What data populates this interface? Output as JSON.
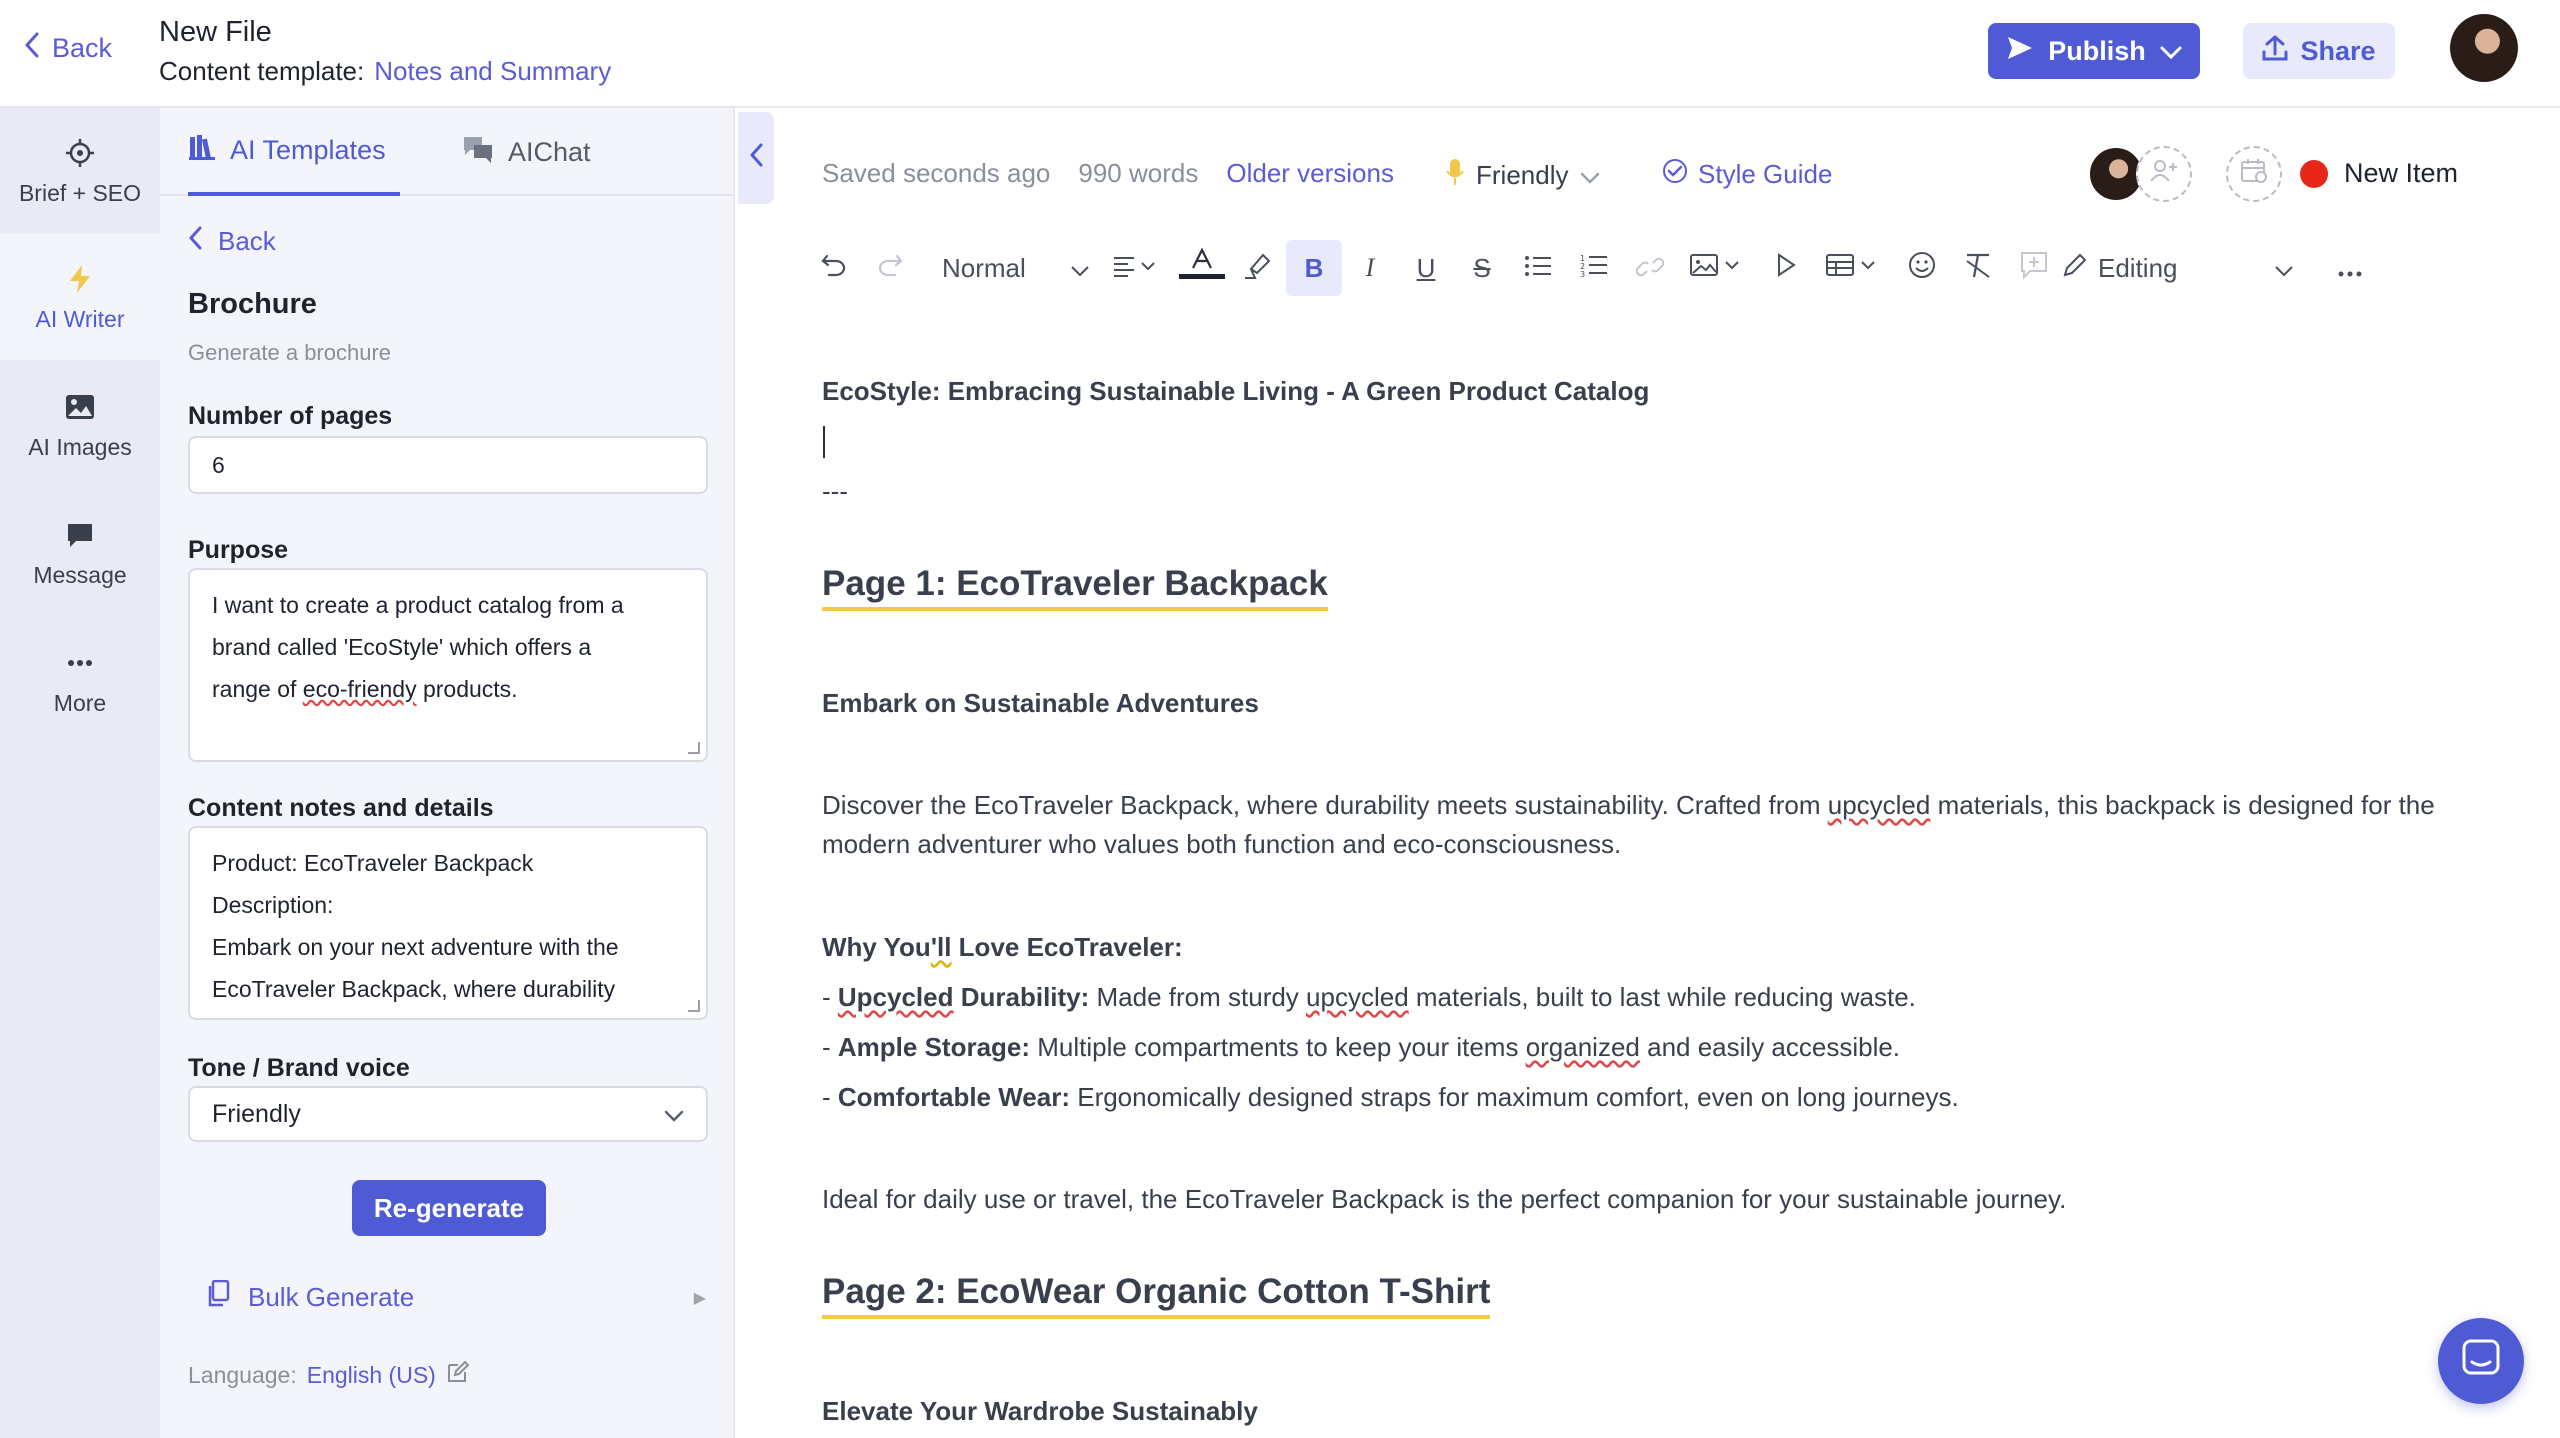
{
  "header": {
    "back_label": "Back",
    "file_title": "New File",
    "template_prefix": "Content template:",
    "template_name": "Notes and Summary",
    "publish_label": "Publish",
    "share_label": "Share"
  },
  "rail": {
    "items": [
      {
        "label": "Brief + SEO",
        "icon": "crosshair-icon"
      },
      {
        "label": "AI Writer",
        "icon": "lightning-icon"
      },
      {
        "label": "AI Images",
        "icon": "image-icon"
      },
      {
        "label": "Message",
        "icon": "message-icon"
      },
      {
        "label": "More",
        "icon": "more-dots-icon"
      }
    ]
  },
  "panel": {
    "tabs": [
      {
        "label": "AI Templates",
        "icon": "templates-icon"
      },
      {
        "label": "AIChat",
        "icon": "chat-icon"
      }
    ],
    "back_label": "Back",
    "title": "Brochure",
    "subtitle": "Generate a brochure",
    "pages_label": "Number of pages",
    "pages_value": "6",
    "purpose_label": "Purpose",
    "purpose_line1": "I want to create a product catalog from a",
    "purpose_line2": "brand called 'EcoStyle' which offers a",
    "purpose_line3_pre": "range of ",
    "purpose_line3_sq": "eco-friendy",
    "purpose_line3_post": " products.",
    "notes_label": "Content notes and details",
    "notes_lines": [
      "Product: EcoTraveler Backpack",
      "Description:",
      "Embark on your next adventure with the",
      "EcoTraveler Backpack, where durability"
    ],
    "tone_label": "Tone / Brand voice",
    "tone_value": "Friendly",
    "regenerate_label": "Re-generate",
    "bulk_label": "Bulk Generate",
    "language_prefix": "Language:",
    "language_value": "English (US)"
  },
  "editor": {
    "saved_status": "Saved seconds ago",
    "word_count": "990 words",
    "older_versions": "Older versions",
    "tone": "Friendly",
    "style_guide": "Style Guide",
    "new_item": "New Item",
    "toolbar": {
      "paragraph_style": "Normal",
      "mode": "Editing"
    }
  },
  "document": {
    "title": "EcoStyle: Embracing Sustainable Living - A Green Product Catalog",
    "separator": "---",
    "page1_heading": "Page 1: EcoTraveler Backpack",
    "page1_subheading": "Embark on Sustainable Adventures",
    "page1_intro_pre": "Discover the EcoTraveler Backpack, where durability meets sustainability. Crafted from ",
    "page1_intro_sq": "upcycled",
    "page1_intro_post": " materials, this backpack is designed for the modern adventurer who values both function and eco-consciousness.",
    "why_pre": "Why You",
    "why_sq": "'ll",
    "why_post": " Love EcoTraveler:",
    "bullet1_dash": "- ",
    "bullet1_bold_sq": "Upcycled",
    "bullet1_bold_rest": " Durability:",
    "bullet1_pre": " Made from sturdy ",
    "bullet1_sq": "upcycled",
    "bullet1_post": " materials, built to last while reducing waste.",
    "bullet2_dash": "- ",
    "bullet2_bold": "Ample Storage:",
    "bullet2_pre": " Multiple compartments to keep your items ",
    "bullet2_sq": "organized",
    "bullet2_post": " and easily accessible.",
    "bullet3_dash": "- ",
    "bullet3_bold": "Comfortable Wear:",
    "bullet3_text": " Ergonomically designed straps for maximum comfort, even on long journeys.",
    "page1_closing": "Ideal for daily use or travel, the EcoTraveler Backpack is the perfect companion for your sustainable journey.",
    "page2_heading": "Page 2: EcoWear Organic Cotton T-Shirt",
    "page2_subheading": "Elevate Your Wardrobe Sustainably"
  },
  "colors": {
    "accent": "#4f5bd5",
    "heading_underline": "#f2c84b",
    "status_red": "#e8261a"
  }
}
